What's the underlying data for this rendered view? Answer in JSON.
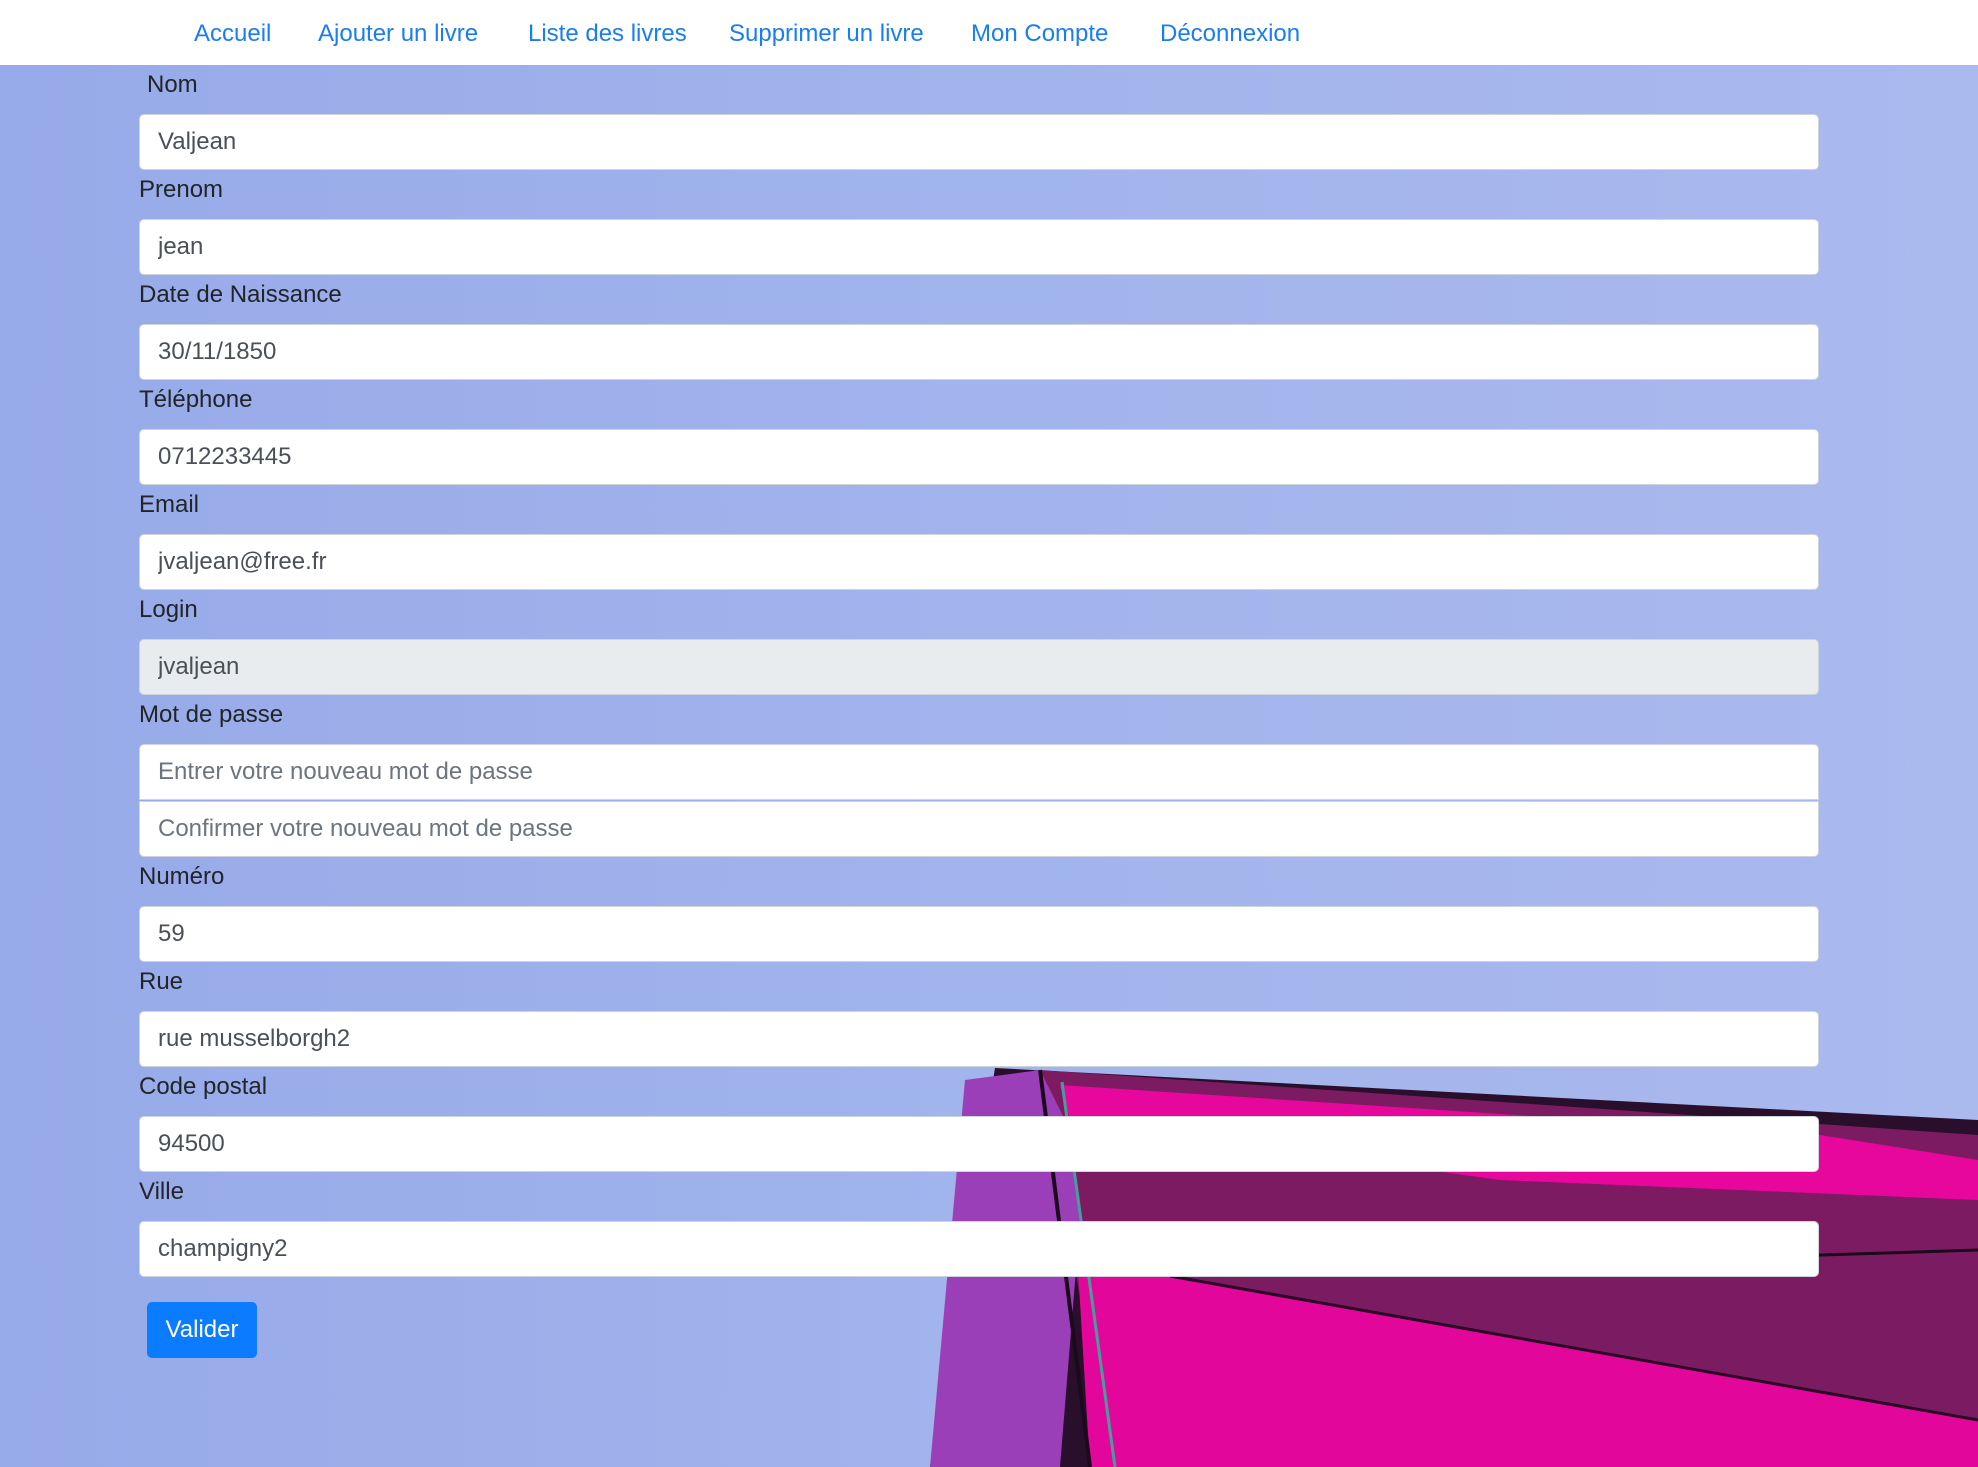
{
  "nav": {
    "items": [
      {
        "label": "Accueil"
      },
      {
        "label": "Ajouter un livre"
      },
      {
        "label": "Liste des livres"
      },
      {
        "label": "Supprimer un livre"
      },
      {
        "label": "Mon Compte"
      },
      {
        "label": "Déconnexion"
      }
    ]
  },
  "form": {
    "nom": {
      "label": "Nom",
      "value": "Valjean"
    },
    "prenom": {
      "label": "Prenom",
      "value": "jean"
    },
    "naissance": {
      "label": "Date de Naissance",
      "value": "30/11/1850"
    },
    "telephone": {
      "label": "Téléphone",
      "value": "0712233445"
    },
    "email": {
      "label": "Email",
      "value": "jvaljean@free.fr"
    },
    "login": {
      "label": "Login",
      "value": "jvaljean"
    },
    "password": {
      "label": "Mot de passe",
      "new_placeholder": "Entrer votre nouveau mot de passe",
      "confirm_placeholder": "Confirmer votre nouveau mot de passe"
    },
    "numero": {
      "label": "Numéro",
      "value": "59"
    },
    "rue": {
      "label": "Rue",
      "value": "rue musselborgh2"
    },
    "code_postal": {
      "label": "Code postal",
      "value": "94500"
    },
    "ville": {
      "label": "Ville",
      "value": "champigny2"
    },
    "submit_label": "Valider"
  },
  "colors": {
    "link": "#1a7df0",
    "button": "#0b7bff",
    "background": "#9fb2ec",
    "accent_magenta": "#e6089c",
    "accent_purple": "#7d1a63"
  }
}
